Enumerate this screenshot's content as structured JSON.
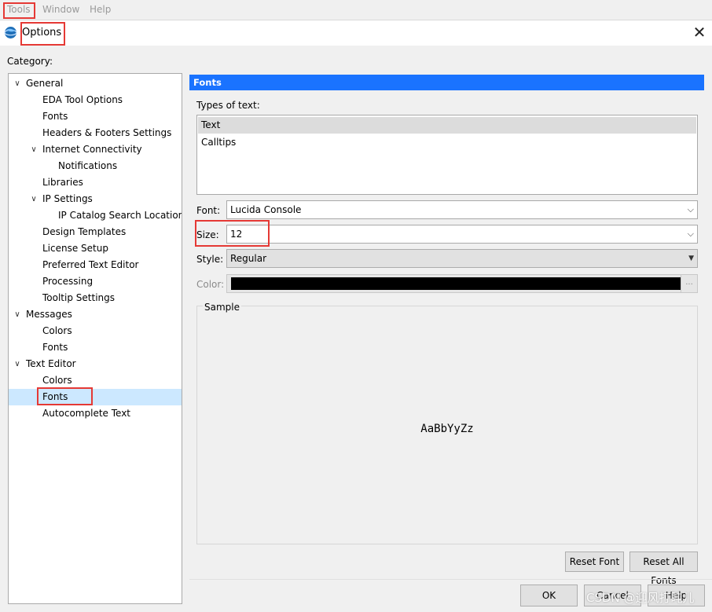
{
  "menubar": {
    "items": [
      {
        "label": "Tools",
        "mnemonic": "T"
      },
      {
        "label": "Window",
        "mnemonic": "W"
      },
      {
        "label": "Help",
        "mnemonic": "H"
      }
    ]
  },
  "window": {
    "title": "Options",
    "icon": "app-globe-icon",
    "close_glyph": "✕"
  },
  "category": {
    "label": "Category:",
    "tree": [
      {
        "label": "General",
        "level": 0,
        "expanded": true
      },
      {
        "label": "EDA Tool Options",
        "level": 1
      },
      {
        "label": "Fonts",
        "level": 1
      },
      {
        "label": "Headers & Footers Settings",
        "level": 1
      },
      {
        "label": "Internet Connectivity",
        "level": 1,
        "expanded": true
      },
      {
        "label": "Notifications",
        "level": 2
      },
      {
        "label": "Libraries",
        "level": 1
      },
      {
        "label": "IP Settings",
        "level": 1,
        "expanded": true
      },
      {
        "label": "IP Catalog Search Locations",
        "level": 2
      },
      {
        "label": "Design Templates",
        "level": 1
      },
      {
        "label": "License Setup",
        "level": 1
      },
      {
        "label": "Preferred Text Editor",
        "level": 1
      },
      {
        "label": "Processing",
        "level": 1
      },
      {
        "label": "Tooltip Settings",
        "level": 1
      },
      {
        "label": "Messages",
        "level": 0,
        "expanded": true
      },
      {
        "label": "Colors",
        "level": 1
      },
      {
        "label": "Fonts",
        "level": 1
      },
      {
        "label": "Text Editor",
        "level": 0,
        "expanded": true
      },
      {
        "label": "Colors",
        "level": 1
      },
      {
        "label": "Fonts",
        "level": 1,
        "selected": true
      },
      {
        "label": "Autocomplete Text",
        "level": 1
      }
    ]
  },
  "panel": {
    "header": "Fonts",
    "types_label": "Types of text:",
    "types": [
      {
        "label": "Text",
        "selected": true
      },
      {
        "label": "Calltips"
      }
    ],
    "font_label": "Font:",
    "font_value": "Lucida Console",
    "size_label": "Size:",
    "size_value": "12",
    "style_label": "Style:",
    "style_value": "Regular",
    "color_label": "Color:",
    "color_value": "#000000",
    "color_button": "...",
    "sample_label": "Sample",
    "sample_text": "AaBbYyZz",
    "reset_font": "Reset Font",
    "reset_all": "Reset All Fonts"
  },
  "footer": {
    "ok": "OK",
    "cancel": "Cancel",
    "help": "Help"
  },
  "watermark": "CSDN @迎风打盹儿",
  "colors": {
    "header_blue": "#1a73ff",
    "selection": "#cce8ff",
    "highlight_red": "#e53935"
  }
}
